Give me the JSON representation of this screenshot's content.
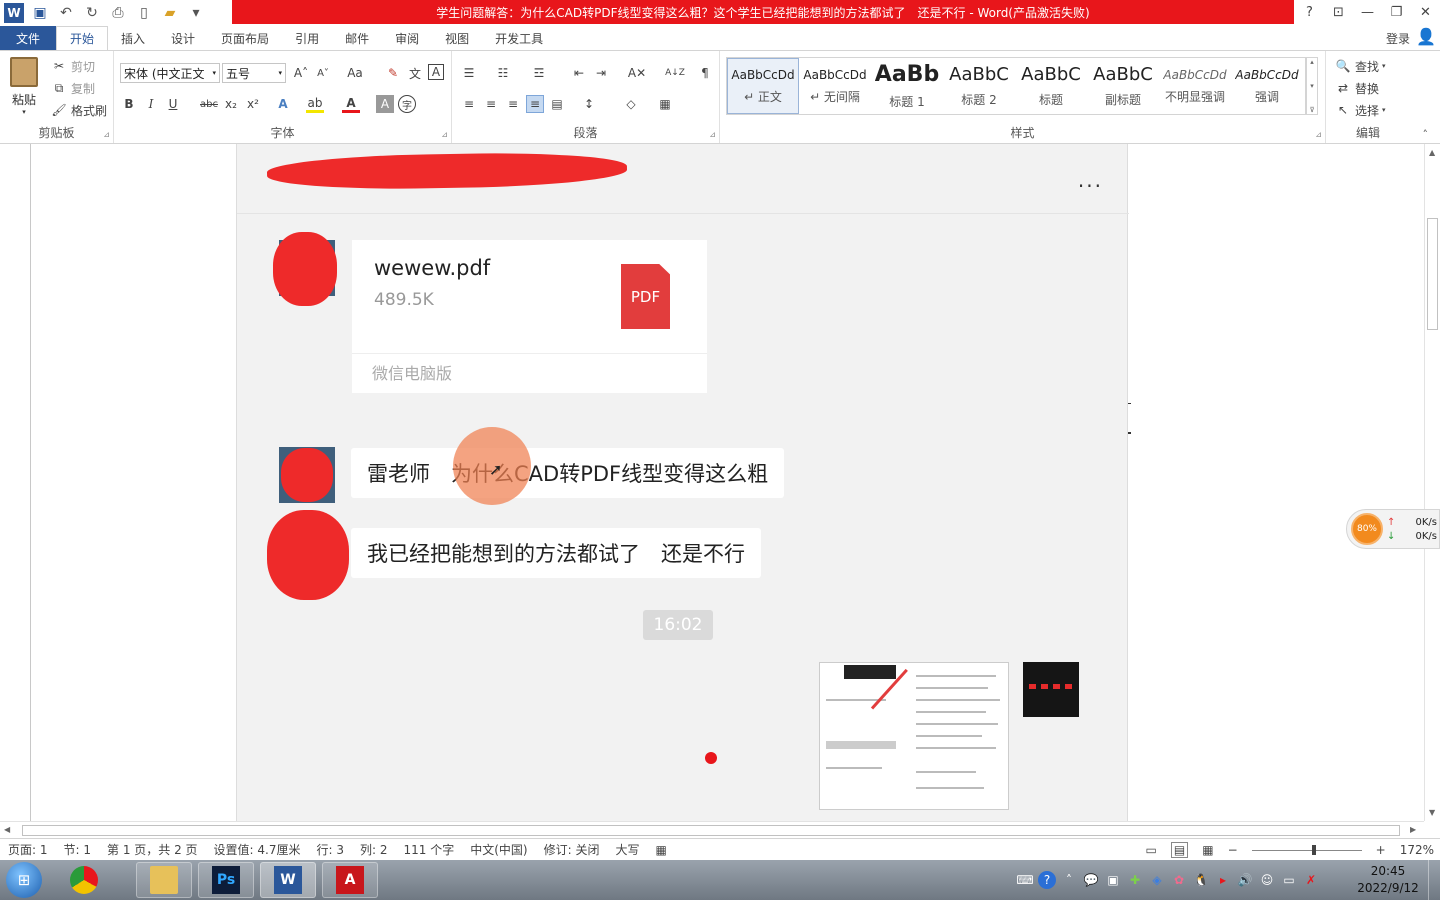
{
  "titlebar": {
    "title": "学生问题解答：为什么CAD转PDF线型变得这么粗？这个学生已经把能想到的方法都试了　还是不行 - Word(产品激活失败)",
    "help": "?",
    "ribbon_display": "⊡",
    "minimize": "—",
    "restore": "❐",
    "close": "✕",
    "title_bar_color": "#e8161b"
  },
  "qat": {
    "word_icon": "W",
    "save_icon": "💾",
    "undo_icon": "↶",
    "redo_icon": "↻",
    "preview_icon": "🔍",
    "new_icon": "🗋",
    "open_icon": "📂",
    "more_icon": "▾"
  },
  "tabs": {
    "file": "文件",
    "items": [
      "开始",
      "插入",
      "设计",
      "页面布局",
      "引用",
      "邮件",
      "审阅",
      "视图",
      "开发工具"
    ],
    "login": "登录"
  },
  "ribbon": {
    "clipboard": {
      "label": "剪贴板",
      "paste": "粘贴",
      "cut": "剪切",
      "copy": "复制",
      "format_painter": "格式刷"
    },
    "font": {
      "label": "字体",
      "font_name": "宋体 (中文正文",
      "font_size": "五号",
      "grow": "A˄",
      "shrink": "A˅",
      "case": "Aa",
      "clear": "A✗",
      "phonetic": "文",
      "border": "A",
      "bold": "B",
      "italic": "I",
      "underline": "U",
      "strike": "abc",
      "subscript": "x₂",
      "superscript": "x²",
      "text_effect": "A",
      "highlight": "ab",
      "font_color": "A",
      "shading": "A",
      "enclose": "字"
    },
    "paragraph": {
      "label": "段落",
      "bullets": "☰",
      "numbering": "☷",
      "multilevel": "☲",
      "decrease_indent": "⇤",
      "increase_indent": "⇥",
      "chinese_layout": "A✕",
      "sort": "A↓Z",
      "show_marks": "¶",
      "align_left": "≡",
      "align_center": "≡",
      "align_right": "≡",
      "justify": "≡",
      "distribute": "▤",
      "line_spacing": "↕",
      "shading": "◇",
      "borders": "▦"
    },
    "styles": {
      "label": "样式",
      "items": [
        {
          "sample": "AaBbCcDd",
          "name": "↵ 正文"
        },
        {
          "sample": "AaBbCcDd",
          "name": "↵ 无间隔"
        },
        {
          "sample": "AaBb",
          "name": "标题 1"
        },
        {
          "sample": "AaBbC",
          "name": "标题 2"
        },
        {
          "sample": "AaBbC",
          "name": "标题"
        },
        {
          "sample": "AaBbC",
          "name": "副标题"
        },
        {
          "sample": "AaBbCcDd",
          "name": "不明显强调"
        },
        {
          "sample": "AaBbCcDd",
          "name": "强调"
        }
      ],
      "scroll_up": "▴",
      "scroll_down": "▾",
      "more": "⊽"
    },
    "editing": {
      "label": "编辑",
      "find": "查找",
      "replace": "替换",
      "select": "选择"
    },
    "collapse": "˄"
  },
  "wechat": {
    "more": "...",
    "file_name": "wewew.pdf",
    "file_size": "489.5K",
    "pdf_label": "PDF",
    "file_source": "微信电脑版",
    "message1": "雷老师　为什么CAD转PDF线型变得这么粗",
    "message2": "我已经把能想到的方法都试了　还是不行",
    "time": "16:02"
  },
  "netwidget": {
    "percent": "80%",
    "up_speed": "0K/s",
    "down_speed": "0K/s",
    "up_arrow": "↑",
    "down_arrow": "↓"
  },
  "statusbar": {
    "page": "页面: 1",
    "section": "节: 1",
    "page_of": "第 1 页，共 2 页",
    "position": "设置值: 4.7厘米",
    "line": "行: 3",
    "column": "列: 2",
    "word_count": "111 个字",
    "language": "中文(中国)",
    "track_changes": "修订: 关闭",
    "caps": "大写",
    "macro_icon": "▦",
    "read_mode_icon": "📖",
    "print_layout_icon": "▤",
    "web_layout_icon": "🌐",
    "zoom_out": "−",
    "zoom_in": "+",
    "zoom_level": "172%",
    "zoom_fraction": 0.57
  },
  "taskbar": {
    "start": "⊞",
    "apps": [
      {
        "name": "chrome",
        "glyph": "◉"
      },
      {
        "name": "explorer",
        "glyph": "▭"
      },
      {
        "name": "photoshop",
        "glyph": "Ps"
      },
      {
        "name": "word",
        "glyph": "W"
      },
      {
        "name": "autocad",
        "glyph": "A"
      }
    ],
    "tray": [
      "⌨",
      "?",
      "˄",
      "💬",
      "▣",
      "✚",
      "◈",
      "✿",
      "🐧",
      "▸",
      "🔊",
      "☺",
      "▭",
      "✗"
    ],
    "time": "20:45",
    "date": "2022/9/12"
  }
}
